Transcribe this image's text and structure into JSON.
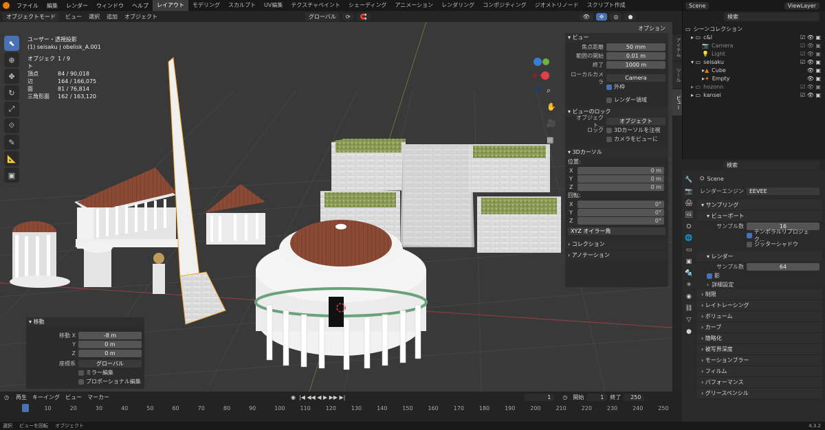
{
  "menu": {
    "items": [
      "ファイル",
      "編集",
      "レンダー",
      "ウィンドウ",
      "ヘルプ"
    ]
  },
  "workspaces": [
    "レイアウト",
    "モデリング",
    "スカルプト",
    "UV編集",
    "テクスチャペイント",
    "シェーディング",
    "アニメーション",
    "レンダリング",
    "コンポジティング",
    "ジオメトリノード",
    "スクリプト作成"
  ],
  "scene_selector": "Scene",
  "view_layer": "ViewLayer",
  "viewport_header": {
    "mode": "オブジェクトモード",
    "view": "ビュー",
    "select": "選択",
    "add": "追加",
    "object": "オブジェクト",
    "orientation": "グローバル",
    "options": "オプション"
  },
  "viewport_info": {
    "projection": "ユーザー・透視投影",
    "collection_object": "(1) seisaku | obelisk_A.001"
  },
  "stats": [
    {
      "k": "オブジェクト",
      "v": "1 / 9"
    },
    {
      "k": "頂点",
      "v": "84 / 90,018"
    },
    {
      "k": "辺",
      "v": "164 / 166,075"
    },
    {
      "k": "面",
      "v": "81 / 76,814"
    },
    {
      "k": "三角形面",
      "v": "162 / 163,120"
    }
  ],
  "npanel": {
    "view_title": "ビュー",
    "focal_label": "焦点距離",
    "focal": "50 mm",
    "clip_start_label": "範囲の開始",
    "clip_start": "0.01 m",
    "clip_end_label": "終了",
    "clip_end": "1000 m",
    "local_camera_label": "ローカルカメラ",
    "local_camera": "Camera",
    "border_label": "外枠",
    "render_region": "レンダー領域",
    "view_lock_title": "ビューのロック",
    "lock_object_label": "オブジェクト...",
    "lock_object_placeholder": "オブジェクト",
    "lock_label": "ロック",
    "lock_cursor": "3Dカーソルを注視",
    "lock_camera": "カメラをビューに",
    "cursor_title": "3Dカーソル",
    "location_label": "位置:",
    "loc": [
      {
        "a": "X",
        "v": "0 m"
      },
      {
        "a": "Y",
        "v": "0 m"
      },
      {
        "a": "Z",
        "v": "0 m"
      }
    ],
    "rotation_label": "回転:",
    "rot": [
      {
        "a": "X",
        "v": "0°"
      },
      {
        "a": "Y",
        "v": "0°"
      },
      {
        "a": "Z",
        "v": "0°"
      }
    ],
    "euler": "XYZ オイラー角",
    "collections": "コレクション",
    "annotations": "アノテーション"
  },
  "side_tabs": [
    "アイテム",
    "ツール",
    "ビュー"
  ],
  "operator": {
    "title": "移動",
    "move_x_label": "移動 X",
    "move_x": "-8 m",
    "y_label": "Y",
    "y": "0 m",
    "z_label": "Z",
    "z": "0 m",
    "orient_label": "座標系",
    "orient": "グローバル",
    "mirror": "ミラー編集",
    "proportional": "プロポーショナル編集"
  },
  "timeline": {
    "playback": "再生",
    "keying": "キーイング",
    "view": "ビュー",
    "marker": "マーカー",
    "current_frame": "1",
    "start_label": "開始",
    "start": "1",
    "end_label": "終了",
    "end": "250",
    "ticks": [
      "1",
      "10",
      "20",
      "30",
      "40",
      "50",
      "60",
      "70",
      "80",
      "90",
      "100",
      "110",
      "120",
      "130",
      "140",
      "150",
      "160",
      "170",
      "180",
      "190",
      "200",
      "210",
      "220",
      "230",
      "240",
      "250"
    ]
  },
  "statusbar": {
    "select": "選択",
    "rotate": "ビューを回転",
    "object": "オブジェクト",
    "version": "4.3.2"
  },
  "outliner": {
    "search_placeholder": "検索",
    "root": "シーンコレクション",
    "rows": [
      {
        "name": "c&l",
        "depth": 1
      },
      {
        "name": "Camera",
        "depth": 2
      },
      {
        "name": "Light",
        "depth": 2
      },
      {
        "name": "seisaku",
        "depth": 1
      },
      {
        "name": "Cube",
        "depth": 2
      },
      {
        "name": "Empty",
        "depth": 2
      },
      {
        "name": "hozonn",
        "depth": 1
      },
      {
        "name": "kansei",
        "depth": 1
      }
    ]
  },
  "properties": {
    "search_placeholder": "検索",
    "scene": "Scene",
    "engine_label": "レンダーエンジン",
    "engine": "EEVEE",
    "sampling": "サンプリング",
    "viewport": "ビューポート",
    "samples_label": "サンプル数",
    "viewport_samples": "16",
    "temporal": "テンポラルリプロジェク...",
    "jitter": "ジッターシャドウ",
    "render": "レンダー",
    "render_samples": "64",
    "shadow": "影",
    "detail": "詳細設定",
    "sections": [
      "制限",
      "レイトレーシング",
      "ボリューム",
      "カーブ",
      "簡略化",
      "被写界深度",
      "モーションブラー",
      "フィルム",
      "パフォーマンス",
      "グリースペンシル"
    ]
  },
  "colors": {
    "accent": "#4772b3",
    "orange": "#e87d0d",
    "axis_x": "#e0404a",
    "axis_y": "#6fb23b",
    "axis_z": "#3a7bd5"
  }
}
